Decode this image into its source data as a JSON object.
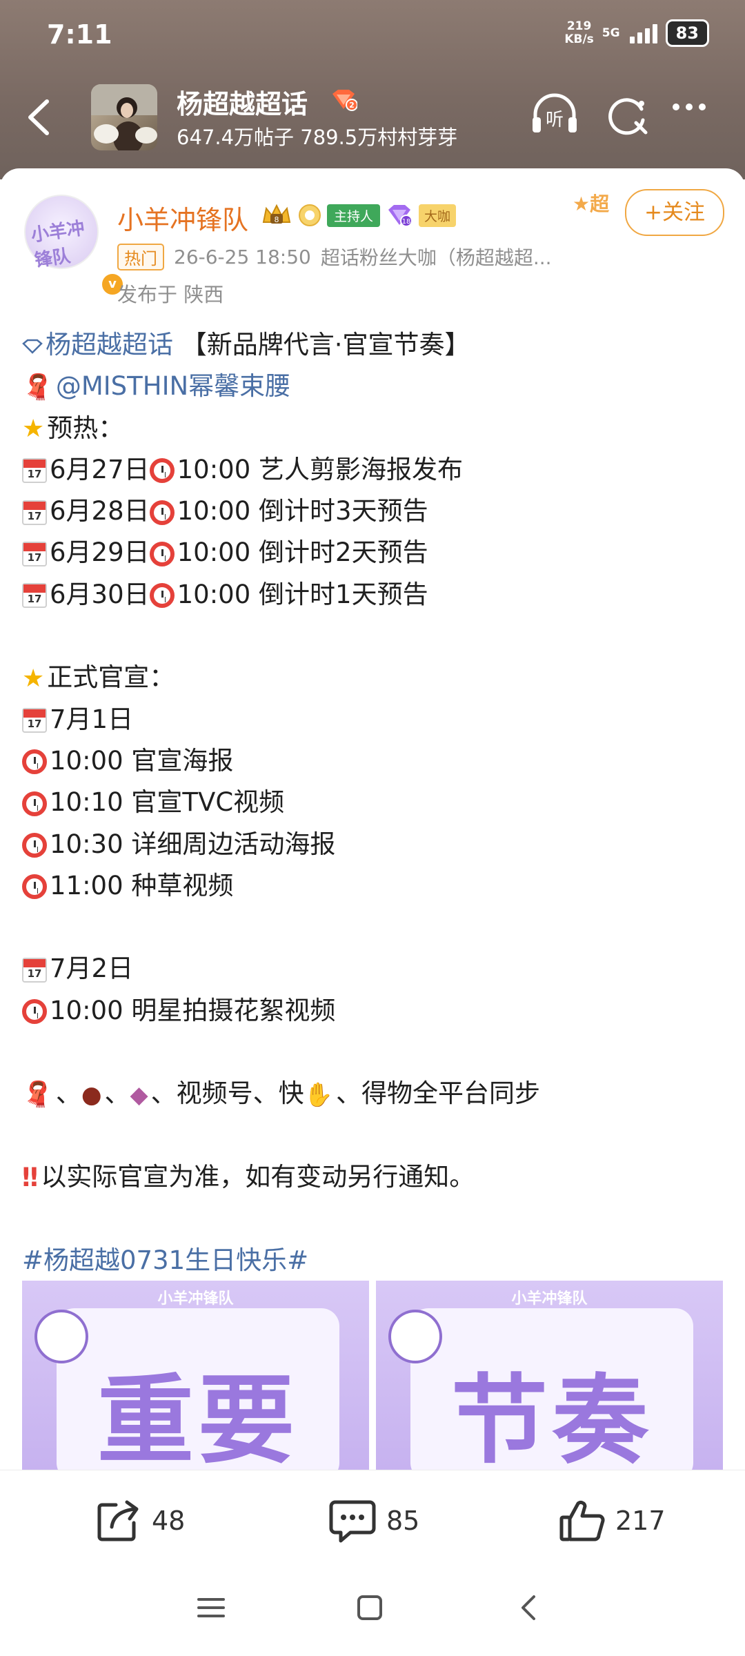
{
  "status": {
    "time": "7:11",
    "net_speed": "219",
    "net_unit": "KB/s",
    "network": "5G",
    "battery": "83"
  },
  "topic": {
    "title": "杨超越超话",
    "stats": "647.4万帖子 789.5万村村芽芽",
    "listen_label": "听"
  },
  "author": {
    "name": "小羊冲锋队",
    "avatar_text": "小羊冲锋队",
    "badge_host": "主持人",
    "badge_level": "大咖",
    "follow_label": "+关注",
    "super_tag": "超",
    "hot_tag": "热门",
    "datetime": "26-6-25 18:50",
    "fan_title": "超话粉丝大咖（杨超越超...",
    "location": "发布于 陕西"
  },
  "post": {
    "topic_link": "杨超越超话",
    "headline": "【新品牌代言·官宣节奏】",
    "brand_mention": "@MISTHIN幂馨束腰",
    "warmup_title": "预热：",
    "warmup": [
      {
        "date": "6月27日",
        "time": "10:00",
        "text": "艺人剪影海报发布"
      },
      {
        "date": "6月28日",
        "time": "10:00",
        "text": "倒计时3天预告"
      },
      {
        "date": "6月29日",
        "time": "10:00",
        "text": "倒计时2天预告"
      },
      {
        "date": "6月30日",
        "time": "10:00",
        "text": "倒计时1天预告"
      }
    ],
    "official_title": "正式官宣：",
    "day1_date": "7月1日",
    "day1_items": [
      {
        "time": "10:00",
        "text": "官宣海报"
      },
      {
        "time": "10:10",
        "text": "官宣TVC视频"
      },
      {
        "time": "10:30",
        "text": "详细周边活动海报"
      },
      {
        "time": "11:00",
        "text": "种草视频"
      }
    ],
    "day2_date": "7月2日",
    "day2_items": [
      {
        "time": "10:00",
        "text": "明星拍摄花絮视频"
      }
    ],
    "platforms_text": "、视频号、快",
    "platforms_tail": "、得物全平台同步",
    "notice": "以实际官宣为准，如有变动另行通知。",
    "hashtag": "#杨超越0731生日快乐#"
  },
  "images": [
    {
      "brand": "小羊冲锋队",
      "text": "重要"
    },
    {
      "brand": "小羊冲锋队",
      "text": "节奏"
    }
  ],
  "actions": {
    "share_count": "48",
    "comment_count": "85",
    "like_count": "217"
  },
  "colors": {
    "author_orange": "#e57322",
    "link_blue": "#4a6fa5",
    "follow_orange": "#f0a742"
  }
}
